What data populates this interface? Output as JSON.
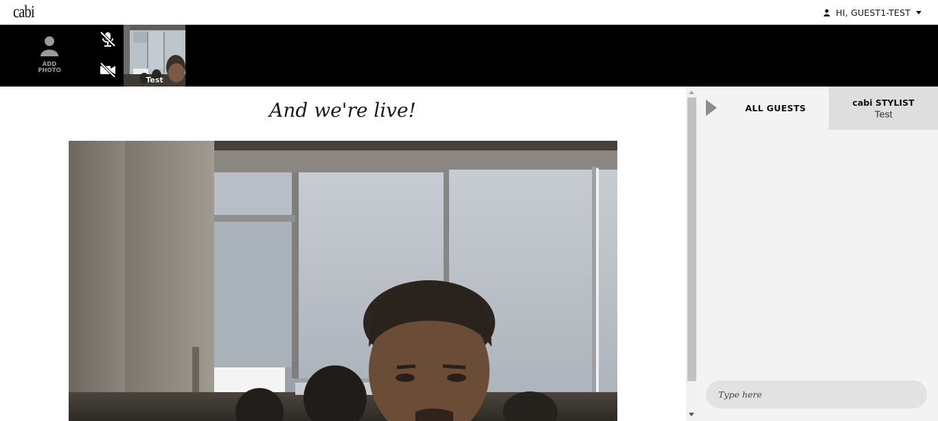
{
  "header": {
    "logo_text": "cabi",
    "user_icon": "user-icon",
    "greeting": "HI, GUEST1-TEST",
    "dropdown_icon": "caret-down-icon"
  },
  "toolbar": {
    "add_photo_label": "ADD\nPHOTO",
    "mic_state": "muted",
    "camera_state": "off",
    "self_preview_name": "Test"
  },
  "stage": {
    "title": "And we're live!"
  },
  "chat": {
    "tabs": {
      "all_guests": "ALL GUESTS",
      "stylist_title": "cabi STYLIST",
      "stylist_name": "Test"
    },
    "input_placeholder": "Type here"
  },
  "colors": {
    "strip_background": "#000000",
    "chat_background": "#f3f3f3",
    "active_stylist_tab": "#dedede"
  }
}
